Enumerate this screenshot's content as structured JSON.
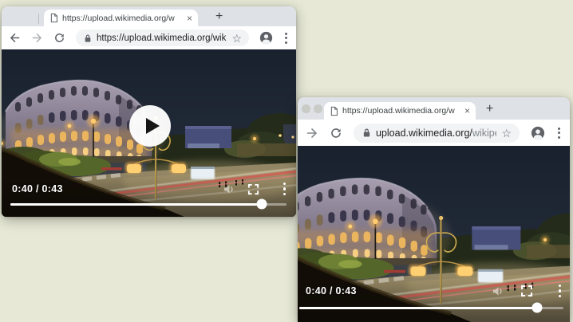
{
  "desktop": {
    "background_color": "#e7e9d6"
  },
  "icons": {
    "close_tab": "×",
    "new_tab": "+",
    "bookmark_star": "☆"
  },
  "window1": {
    "tab": {
      "title": "https://upload.wikimedia.org/w"
    },
    "address": {
      "url": "https://upload.wikimedia.org/wik..."
    },
    "player": {
      "time_display": "0:40 / 0:43",
      "current_time": "0:40",
      "duration": "0:43",
      "progress_pct": 91,
      "state": "paused"
    }
  },
  "window2": {
    "tab": {
      "title": "https://upload.wikimedia.org/w"
    },
    "address": {
      "url_host": "upload.wikimedia.org/",
      "url_path": "wikipedia/..."
    },
    "player": {
      "time_display": "0:40 / 0:43",
      "current_time": "0:40",
      "duration": "0:43",
      "progress_pct": 90,
      "state": "paused"
    }
  },
  "colors": {
    "tabstrip": "#dee1e6",
    "toolbar": "#ffffff",
    "omnibox": "#f1f3f4",
    "url_text": "#202124",
    "url_muted": "#80868b",
    "night_sky": "#222b3a",
    "arch_glow": "#eab55e",
    "player_text": "#ffffff"
  }
}
